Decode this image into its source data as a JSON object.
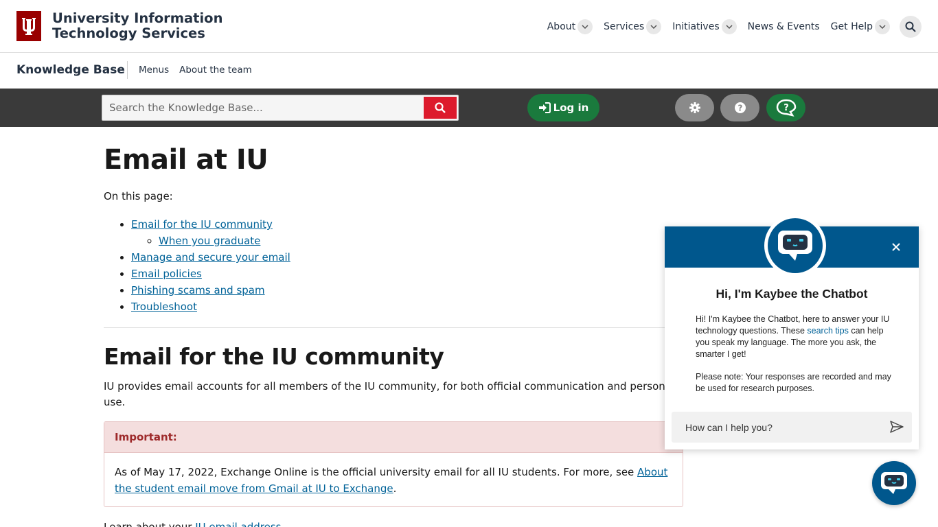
{
  "header": {
    "site_title_line1": "University Information",
    "site_title_line2": "Technology Services",
    "nav": [
      {
        "label": "About"
      },
      {
        "label": "Services"
      },
      {
        "label": "Initiatives"
      },
      {
        "label": "News & Events"
      },
      {
        "label": "Get Help"
      }
    ]
  },
  "kb_bar": {
    "title": "Knowledge Base",
    "links": [
      "Menus",
      "About the team"
    ]
  },
  "toolbar": {
    "search_placeholder": "Search the Knowledge Base...",
    "login_label": "Log in"
  },
  "main": {
    "title": "Email at IU",
    "on_this_page": "On this page:",
    "toc": [
      "Email for the IU community",
      "When you graduate",
      "Manage and secure your email",
      "Email policies",
      "Phishing scams and spam",
      "Troubleshoot"
    ],
    "section_heading": "Email for the IU community",
    "intro": "IU provides email accounts for all members of the IU community, for both official communication and personal use.",
    "callout": {
      "heading": "Important:",
      "body_text": "As of May 17, 2022, Exchange Online is the official university email for all IU students. For more, see ",
      "link": "About the student email move from Gmail at IU to Exchange",
      "end": "."
    },
    "learn_text": "Learn about your ",
    "learn_link": "IU email address"
  },
  "chatbot": {
    "title": "Hi, I'm Kaybee the Chatbot",
    "msg_part1": "Hi! I'm Kaybee the Chatbot, here to answer your IU technology questions. These ",
    "msg_link": "search tips",
    "msg_part2": " can help you speak my language. The more you ask, the smarter I get!",
    "note": "Please note: Your responses are recorded and may be used for research purposes.",
    "input_placeholder": "How can I help you?"
  },
  "colors": {
    "iu_crimson": "#990000",
    "search_red": "#dd1a2c",
    "login_green": "#1a7a3d",
    "chat_blue": "#00578d",
    "link_blue": "#006298"
  }
}
